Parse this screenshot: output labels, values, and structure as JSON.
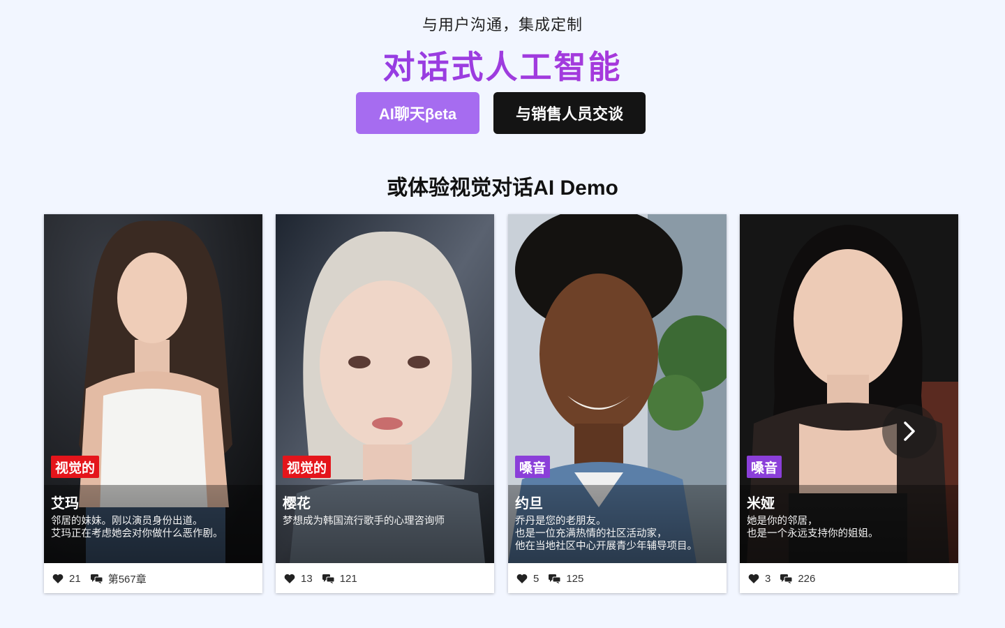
{
  "header": {
    "subtitle": "与用户沟通，集成定制",
    "title": "对话式人工智能",
    "buttons": {
      "chat": "AI聊天βeta",
      "sales": "与销售人员交谈"
    }
  },
  "section_title": "或体验视觉对话AI Demo",
  "cards": [
    {
      "tag": "视觉的",
      "tag_color": "#e4151b",
      "name": "艾玛",
      "desc": [
        "邻居的妹妹。刚以演员身份出道。",
        "艾玛正在考虑她会对你做什么恶作剧。"
      ],
      "likes": "21",
      "comments": "第567章"
    },
    {
      "tag": "视觉的",
      "tag_color": "#e4151b",
      "name": "樱花",
      "desc": [
        "梦想成为韩国流行歌手的心理咨询师"
      ],
      "likes": "13",
      "comments": "121"
    },
    {
      "tag": "嗓音",
      "tag_color": "#8b3fd9",
      "name": "约旦",
      "desc": [
        "乔丹是您的老朋友。",
        "也是一位充满热情的社区活动家，",
        "他在当地社区中心开展青少年辅导项目。"
      ],
      "likes": "5",
      "comments": "125"
    },
    {
      "tag": "嗓音",
      "tag_color": "#8b3fd9",
      "name": "米娅",
      "desc": [
        "她是你的邻居，",
        "也是一个永远支持你的姐姐。"
      ],
      "likes": "3",
      "comments": "226"
    }
  ],
  "icons": {
    "like": "heart-icon",
    "comment": "chat-bubbles-icon",
    "next": "chevron-right-icon"
  },
  "colors": {
    "accent": "#a66cf0",
    "dark_button": "#141414",
    "background": "#f2f6ff"
  }
}
